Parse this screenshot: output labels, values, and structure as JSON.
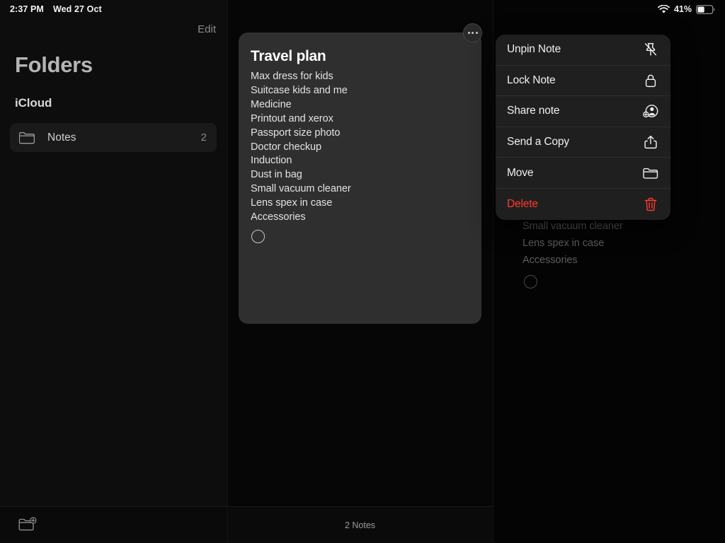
{
  "status_bar": {
    "time": "2:37 PM",
    "date": "Wed 27 Oct",
    "battery_percent": "41%",
    "wifi_icon": "wifi-icon",
    "battery_icon": "battery-icon"
  },
  "sidebar": {
    "edit_label": "Edit",
    "title": "Folders",
    "section_header": "iCloud",
    "folder": {
      "icon": "folder-icon",
      "label": "Notes",
      "count": "2",
      "selected": true
    },
    "toolbar": {
      "new_folder_icon": "new-folder-icon"
    }
  },
  "notes_list": {
    "more_button_icon": "ellipsis-circle-icon",
    "note_card": {
      "title": "Travel plan",
      "lines": [
        "Max dress for kids",
        "Suitcase kids and me",
        "Medicine",
        "Printout and xerox",
        "Passport size photo",
        "Doctor checkup",
        "Induction",
        "Dust in bag",
        "Small vacuum cleaner",
        "Lens spex in case",
        "Accessories"
      ],
      "trailing_checkbox": "unchecked-circle-icon"
    },
    "footer_label": "2 Notes"
  },
  "detail_view": {
    "visible_lines": [
      "Small vacuum cleaner",
      "Lens spex in case",
      "Accessories"
    ],
    "trailing_checkbox": "unchecked-circle-icon"
  },
  "context_menu": {
    "items": [
      {
        "label": "Unpin Note",
        "icon": "pin-slash-icon",
        "destructive": false
      },
      {
        "label": "Lock Note",
        "icon": "lock-icon",
        "destructive": false
      },
      {
        "label": "Share note",
        "icon": "person-add-icon",
        "destructive": false
      },
      {
        "label": "Send a Copy",
        "icon": "share-up-icon",
        "destructive": false
      },
      {
        "label": "Move",
        "icon": "folder-icon",
        "destructive": false
      },
      {
        "label": "Delete",
        "icon": "trash-icon",
        "destructive": true
      }
    ]
  },
  "colors": {
    "background": "#000000",
    "sidebar_bg": "#0d0d0d",
    "card_bg": "#2f2f2f",
    "menu_bg": "#1f1f1f",
    "destructive": "#ff3b30",
    "primary_text": "#f0f0f0"
  }
}
